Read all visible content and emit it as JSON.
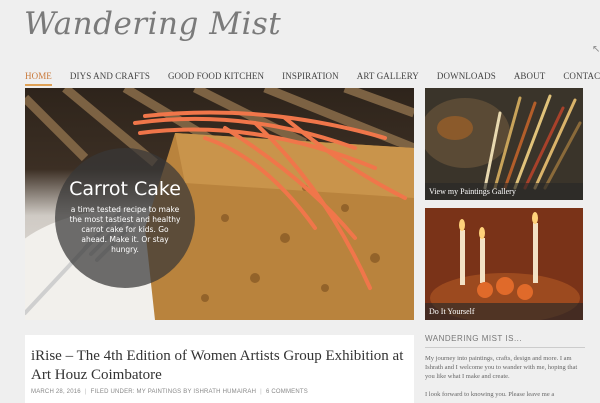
{
  "site": {
    "logo_text": "Wandering Mist"
  },
  "nav": {
    "items": [
      {
        "label": "HOME",
        "active": true
      },
      {
        "label": "DIYS AND CRAFTS"
      },
      {
        "label": "GOOD FOOD KITCHEN"
      },
      {
        "label": "INSPIRATION"
      },
      {
        "label": "ART GALLERY"
      },
      {
        "label": "DOWNLOADS"
      },
      {
        "label": "ABOUT"
      },
      {
        "label": "CONTACT ME"
      }
    ]
  },
  "hero": {
    "title": "Carrot Cake",
    "subtitle": "a time tested recipe to make the most tastiest and healthy carrot cake for kids. Go ahead. Make it. Or stay hungry."
  },
  "thumbs": [
    {
      "caption": "View my Paintings Gallery"
    },
    {
      "caption": "Do It Yourself"
    }
  ],
  "post": {
    "title": "iRise – The 4th Edition of Women Artists Group Exhibition at Art Houz Coimbatore",
    "date": "MARCH 28, 2016",
    "filed": "FILED UNDER: MY PAINTINGS BY ISHRATH HUMAIRAH",
    "comments": "6 COMMENTS"
  },
  "widget": {
    "title": "WANDERING MIST IS...",
    "text": "My journey into paintings, crafts, design and more. I am Ishrath and I welcome you to wander with me, hoping that you like what I make and create.",
    "text2": "I look forward to knowing you. Please leave me a"
  },
  "colors": {
    "accent": "#e0a256",
    "background": "#efefef"
  }
}
